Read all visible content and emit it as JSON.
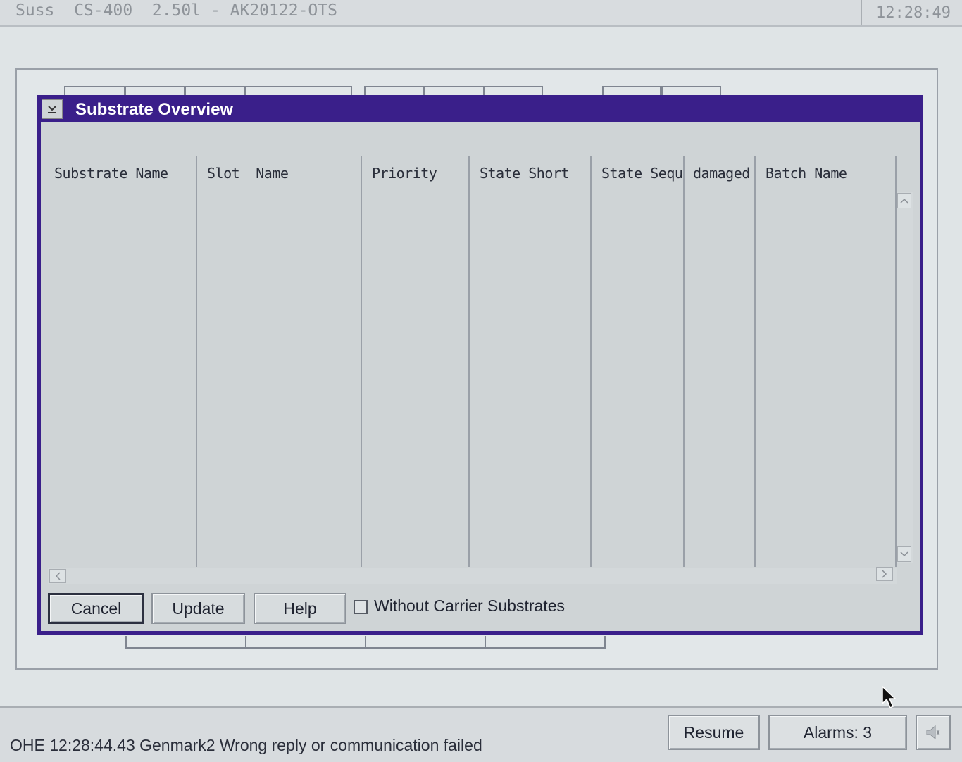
{
  "topbar": {
    "title": "Suss  CS-400  2.50l - AK20122-OTS",
    "clock": "12:28:49"
  },
  "dialog": {
    "title": "Substrate Overview",
    "columns": [
      "Substrate Name",
      "Slot  Name",
      "Priority",
      "State Short",
      "State Sequ",
      "damaged",
      "Batch Name"
    ],
    "buttons": {
      "cancel": "Cancel",
      "update": "Update",
      "help": "Help"
    },
    "checkbox": {
      "label": "Without Carrier Substrates",
      "checked": false
    }
  },
  "statusbar": {
    "message": "OHE 12:28:44.43 Genmark2 Wrong reply or communication failed",
    "resume": "Resume",
    "alarms": "Alarms: 3"
  },
  "colors": {
    "dialog_frame": "#3a1f8a",
    "panel": "#cfd4d6",
    "background": "#dfe4e6"
  }
}
